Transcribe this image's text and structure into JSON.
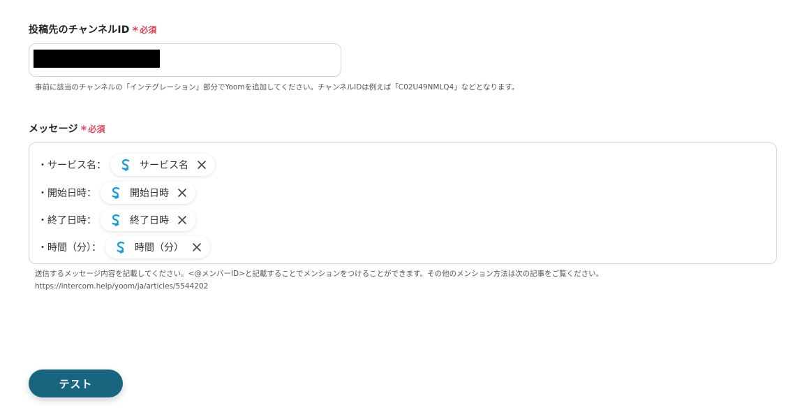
{
  "colors": {
    "required": "#e0455a",
    "button_bg": "#17657f",
    "token_icon": "#1aa0d9",
    "border": "#d3d6db"
  },
  "channel_field": {
    "label": "投稿先のチャンネルID",
    "required_mark": "*",
    "required_text": "必須",
    "value_redacted": true,
    "help": "事前に該当のチャンネルの「インテグレーション」部分でYoomを追加してください。チャンネルIDは例えば「C02U49NMLQ4」などとなります。"
  },
  "message_field": {
    "label": "メッセージ",
    "required_mark": "*",
    "required_text": "必須",
    "lines": [
      {
        "text": "・サービス名：",
        "token": "サービス名",
        "token_icon": "yoom-s-icon"
      },
      {
        "text": "・開始日時：",
        "token": "開始日時",
        "token_icon": "yoom-s-icon"
      },
      {
        "text": "・終了日時：",
        "token": "終了日時",
        "token_icon": "yoom-s-icon"
      },
      {
        "text": "・時間（分）：",
        "token": "時間（分）",
        "token_icon": "yoom-s-icon"
      }
    ],
    "help_line1": "送信するメッセージ内容を記載してください。<@メンバーID>と記載することでメンションをつけることができます。その他のメンション方法は次の記事をご覧ください。",
    "help_line2": "https://intercom.help/yoom/ja/articles/5544202"
  },
  "test_button": {
    "label": "テスト"
  }
}
